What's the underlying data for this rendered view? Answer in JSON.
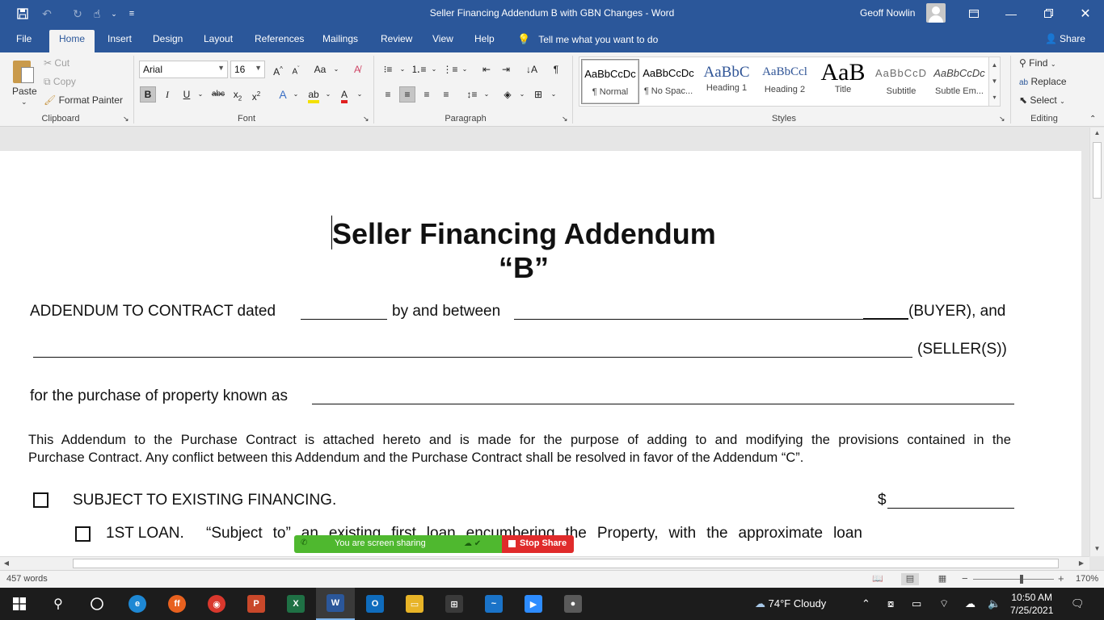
{
  "window": {
    "title": "Seller Financing Addendum B with GBN Changes  -  Word",
    "user": "Geoff Nowlin"
  },
  "tabs": [
    "File",
    "Home",
    "Insert",
    "Design",
    "Layout",
    "References",
    "Mailings",
    "Review",
    "View",
    "Help"
  ],
  "active_tab": "Home",
  "tell_me": "Tell me what you want to do",
  "share": "Share",
  "clipboard": {
    "paste": "Paste",
    "cut": "Cut",
    "copy": "Copy",
    "format_painter": "Format Painter",
    "label": "Clipboard"
  },
  "font": {
    "name": "Arial",
    "size": "16",
    "label": "Font"
  },
  "paragraph": {
    "label": "Paragraph"
  },
  "styles": {
    "label": "Styles",
    "items": [
      {
        "sample": "AaBbCcDc",
        "name": "¶ Normal"
      },
      {
        "sample": "AaBbCcDc",
        "name": "¶ No Spac..."
      },
      {
        "sample": "AaBbC",
        "name": "Heading 1"
      },
      {
        "sample": "AaBbCcl",
        "name": "Heading 2"
      },
      {
        "sample": "AaB",
        "name": "Title"
      },
      {
        "sample": "AaBbCcD",
        "name": "Subtitle"
      },
      {
        "sample": "AaBbCcDc",
        "name": "Subtle Em..."
      }
    ]
  },
  "editing": {
    "find": "Find",
    "replace": "Replace",
    "select": "Select",
    "label": "Editing"
  },
  "document": {
    "heading_line1": "Seller Financing Addendum",
    "heading_line2": "“B”",
    "line1_prefix": "ADDENDUM TO CONTRACT dated",
    "line1_mid": "by and between",
    "line1_suffix": "(BUYER), and",
    "line2_suffix": "(SELLER(S))",
    "line3_prefix": "for the purchase of property known as",
    "para_line1": "This Addendum to the Purchase Contract is attached hereto and is made for the purpose of adding to and modifying the provisions contained in the",
    "para_line2": "Purchase Contract.  Any conflict between this Addendum and the Purchase Contract shall be resolved in favor of the Addendum “C”.",
    "item1": "SUBJECT TO EXISTING FINANCING.",
    "item1_amount": "$",
    "item2_prefix": "1ST LOAN.",
    "item2_text": "“Subject to” an existing first loan encumbering the Property, with the approximate loan"
  },
  "share_bar": {
    "status": "You are screen sharing",
    "stop": "Stop Share"
  },
  "status_bar": {
    "words": "457 words",
    "zoom": "170%",
    "zoom_level_fraction": 0.6
  },
  "taskbar": {
    "weather": "74°F  Cloudy",
    "time": "10:50 AM",
    "date": "7/25/2021",
    "apps": [
      {
        "name": "edge",
        "color": "#1e88d4",
        "label": "e"
      },
      {
        "name": "firefox",
        "color": "#e8611f",
        "label": "ff"
      },
      {
        "name": "chrome",
        "color": "#d9382d",
        "label": "◉"
      },
      {
        "name": "powerpoint",
        "color": "#c9482a",
        "label": "P"
      },
      {
        "name": "excel",
        "color": "#1f7145",
        "label": "X"
      },
      {
        "name": "word",
        "color": "#2b579a",
        "label": "W"
      },
      {
        "name": "outlook",
        "color": "#0f6cbd",
        "label": "O"
      },
      {
        "name": "file-explorer",
        "color": "#e8b427",
        "label": "▭"
      },
      {
        "name": "store",
        "color": "#3a3a3a",
        "label": "⊞"
      },
      {
        "name": "whiteboard",
        "color": "#1a73c8",
        "label": "~"
      },
      {
        "name": "zoom",
        "color": "#2d8cff",
        "label": "▶"
      },
      {
        "name": "recorder",
        "color": "#5a5a5a",
        "label": "●"
      }
    ]
  }
}
